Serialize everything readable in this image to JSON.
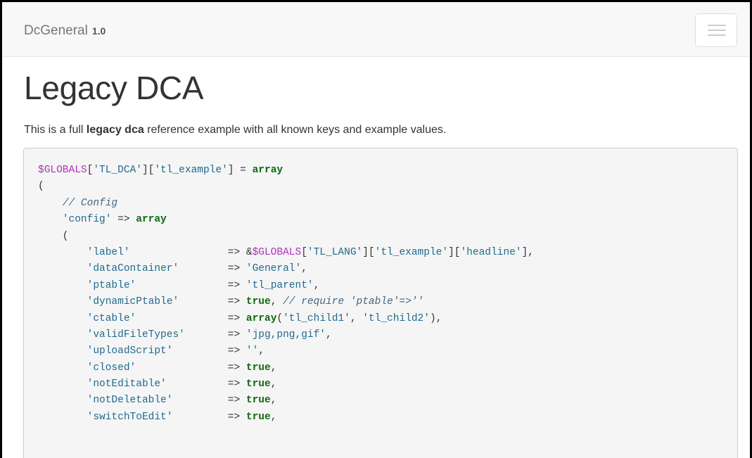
{
  "navbar": {
    "brand": "DcGeneral",
    "version": "1.0",
    "menu_toggle_icon": "hamburger-menu-icon"
  },
  "page": {
    "title": "Legacy DCA",
    "lead_before": "This is a full ",
    "lead_bold": "legacy dca",
    "lead_after": " reference example with all known keys and example values."
  },
  "code": {
    "lines": [
      [
        {
          "t": "var",
          "v": "$GLOBALS"
        },
        {
          "t": "plain",
          "v": "["
        },
        {
          "t": "str",
          "v": "'TL_DCA'"
        },
        {
          "t": "plain",
          "v": "]["
        },
        {
          "t": "str",
          "v": "'tl_example'"
        },
        {
          "t": "plain",
          "v": "] = "
        },
        {
          "t": "kw",
          "v": "array"
        }
      ],
      [
        {
          "t": "plain",
          "v": "("
        }
      ],
      [
        {
          "t": "plain",
          "v": "    "
        },
        {
          "t": "cm",
          "v": "// Config"
        }
      ],
      [
        {
          "t": "plain",
          "v": "    "
        },
        {
          "t": "str",
          "v": "'config'"
        },
        {
          "t": "plain",
          "v": " => "
        },
        {
          "t": "kw",
          "v": "array"
        }
      ],
      [
        {
          "t": "plain",
          "v": "    ("
        }
      ],
      [
        {
          "t": "plain",
          "v": "        "
        },
        {
          "t": "str",
          "v": "'label'"
        },
        {
          "t": "plain",
          "v": "                => &"
        },
        {
          "t": "var",
          "v": "$GLOBALS"
        },
        {
          "t": "plain",
          "v": "["
        },
        {
          "t": "str",
          "v": "'TL_LANG'"
        },
        {
          "t": "plain",
          "v": "]["
        },
        {
          "t": "str",
          "v": "'tl_example'"
        },
        {
          "t": "plain",
          "v": "]["
        },
        {
          "t": "str",
          "v": "'headline'"
        },
        {
          "t": "plain",
          "v": "],"
        }
      ],
      [
        {
          "t": "plain",
          "v": "        "
        },
        {
          "t": "str",
          "v": "'dataContainer'"
        },
        {
          "t": "plain",
          "v": "        => "
        },
        {
          "t": "str",
          "v": "'General'"
        },
        {
          "t": "plain",
          "v": ","
        }
      ],
      [
        {
          "t": "plain",
          "v": "        "
        },
        {
          "t": "str",
          "v": "'ptable'"
        },
        {
          "t": "plain",
          "v": "               => "
        },
        {
          "t": "str",
          "v": "'tl_parent'"
        },
        {
          "t": "plain",
          "v": ","
        }
      ],
      [
        {
          "t": "plain",
          "v": "        "
        },
        {
          "t": "str",
          "v": "'dynamicPtable'"
        },
        {
          "t": "plain",
          "v": "        => "
        },
        {
          "t": "kw",
          "v": "true"
        },
        {
          "t": "plain",
          "v": ", "
        },
        {
          "t": "cm",
          "v": "// require 'ptable'=>''"
        }
      ],
      [
        {
          "t": "plain",
          "v": "        "
        },
        {
          "t": "str",
          "v": "'ctable'"
        },
        {
          "t": "plain",
          "v": "               => "
        },
        {
          "t": "kw",
          "v": "array"
        },
        {
          "t": "plain",
          "v": "("
        },
        {
          "t": "str",
          "v": "'tl_child1'"
        },
        {
          "t": "plain",
          "v": ", "
        },
        {
          "t": "str",
          "v": "'tl_child2'"
        },
        {
          "t": "plain",
          "v": "),"
        }
      ],
      [
        {
          "t": "plain",
          "v": "        "
        },
        {
          "t": "str",
          "v": "'validFileTypes'"
        },
        {
          "t": "plain",
          "v": "       => "
        },
        {
          "t": "str",
          "v": "'jpg,png,gif'"
        },
        {
          "t": "plain",
          "v": ","
        }
      ],
      [
        {
          "t": "plain",
          "v": "        "
        },
        {
          "t": "str",
          "v": "'uploadScript'"
        },
        {
          "t": "plain",
          "v": "         => "
        },
        {
          "t": "str",
          "v": "''"
        },
        {
          "t": "plain",
          "v": ","
        }
      ],
      [
        {
          "t": "plain",
          "v": "        "
        },
        {
          "t": "str",
          "v": "'closed'"
        },
        {
          "t": "plain",
          "v": "               => "
        },
        {
          "t": "kw",
          "v": "true"
        },
        {
          "t": "plain",
          "v": ","
        }
      ],
      [
        {
          "t": "plain",
          "v": "        "
        },
        {
          "t": "str",
          "v": "'notEditable'"
        },
        {
          "t": "plain",
          "v": "          => "
        },
        {
          "t": "kw",
          "v": "true"
        },
        {
          "t": "plain",
          "v": ","
        }
      ],
      [
        {
          "t": "plain",
          "v": "        "
        },
        {
          "t": "str",
          "v": "'notDeletable'"
        },
        {
          "t": "plain",
          "v": "         => "
        },
        {
          "t": "kw",
          "v": "true"
        },
        {
          "t": "plain",
          "v": ","
        }
      ],
      [
        {
          "t": "plain",
          "v": "        "
        },
        {
          "t": "str",
          "v": "'switchToEdit'"
        },
        {
          "t": "plain",
          "v": "         => "
        },
        {
          "t": "kw",
          "v": "true"
        },
        {
          "t": "plain",
          "v": ","
        }
      ]
    ]
  },
  "colors": {
    "variable": "#b030c0",
    "string": "#206a8f",
    "keyword": "#106a10",
    "comment": "#446680"
  }
}
